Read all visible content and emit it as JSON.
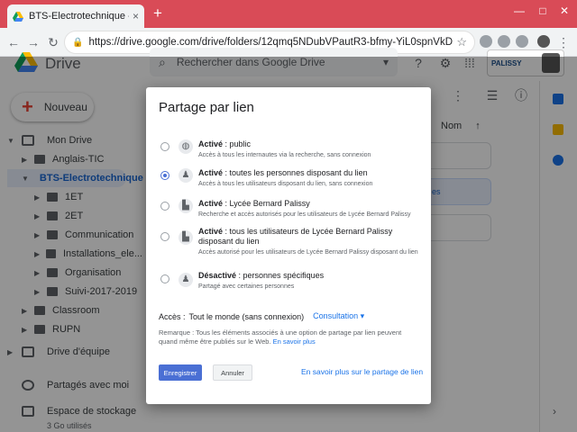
{
  "browser": {
    "tab_title": "BTS-Electrotechnique - Google D",
    "tab_close": "×",
    "new_tab": "+",
    "window_controls": [
      "—",
      "□",
      "✕"
    ],
    "url": "https://drive.google.com/drive/folders/12qmq5NDubVPautR3-bfmy-YiL0spnVkD",
    "nav": [
      "←",
      "→",
      "↻"
    ]
  },
  "app": {
    "brand": "Drive",
    "search_placeholder": "Rechercher dans Google Drive",
    "top_icons": [
      "help-icon",
      "settings-icon",
      "apps-icon"
    ],
    "org_logo_text": "PALISSY",
    "new_button": "Nouveau",
    "sidebar": {
      "my_drive": "Mon Drive",
      "folders": [
        {
          "label": "Anglais-TIC",
          "level": 1,
          "selected": false
        },
        {
          "label": "BTS-Electrotechnique",
          "level": 1,
          "selected": true
        },
        {
          "label": "1ET",
          "level": 2,
          "selected": false
        },
        {
          "label": "2ET",
          "level": 2,
          "selected": false
        },
        {
          "label": "Communication",
          "level": 2,
          "selected": false
        },
        {
          "label": "Installations_ele...",
          "level": 2,
          "selected": false
        },
        {
          "label": "Organisation",
          "level": 2,
          "selected": false
        },
        {
          "label": "Suivi-2017-2019",
          "level": 2,
          "selected": false
        },
        {
          "label": "Classroom",
          "level": 1,
          "selected": false
        },
        {
          "label": "RUPN",
          "level": 1,
          "selected": false
        }
      ],
      "team_drive": "Drive d'équipe",
      "shared": "Partagés avec moi",
      "storage": "Espace de stockage",
      "storage_used": "3 Go utilisés"
    },
    "list_header": "Nom",
    "sort_arrow": "↑",
    "peek_text": "es"
  },
  "dialog": {
    "title": "Partage par lien",
    "options": [
      {
        "title_bold": "Activé",
        "title_rest": " : public",
        "desc": "Accès à tous les internautes via la recherche, sans connexion",
        "icon": "globe-icon",
        "glyph": "◍",
        "selected": false
      },
      {
        "title_bold": "Activé",
        "title_rest": " : toutes les personnes disposant du lien",
        "desc": "Accès à tous les utilisateurs disposant du lien, sans connexion",
        "icon": "person-link-icon",
        "glyph": "♟",
        "selected": true
      },
      {
        "title_bold": "Activé",
        "title_rest": " : Lycée Bernard Palissy",
        "desc": "Recherche et accès autorisés pour les utilisateurs de Lycée Bernard Palissy",
        "icon": "building-icon",
        "glyph": "▙",
        "selected": false
      },
      {
        "title_bold": "Activé",
        "title_rest": " : tous les utilisateurs de Lycée Bernard Palissy disposant du lien",
        "desc": "Accès autorisé pour les utilisateurs de Lycée Bernard Palissy disposant du lien",
        "icon": "building-link-icon",
        "glyph": "▙",
        "selected": false
      },
      {
        "title_bold": "Désactivé",
        "title_rest": " : personnes spécifiques",
        "desc": "Partagé avec certaines personnes",
        "icon": "person-icon",
        "glyph": "♟",
        "selected": false
      }
    ],
    "access_label": "Accès :",
    "access_value": "Tout le monde (sans connexion)",
    "access_role": "Consultation ▾",
    "remark": "Remarque : Tous les éléments associés à une option de partage par lien peuvent quand même être publiés sur le Web.",
    "remark_link": "En savoir plus",
    "save": "Enregistrer",
    "cancel": "Annuler",
    "learn_more": "En savoir plus sur le partage de lien"
  },
  "colors": {
    "chrome_accent": "#d94b57",
    "primary": "#4a6fd4",
    "link": "#1a73e8"
  }
}
